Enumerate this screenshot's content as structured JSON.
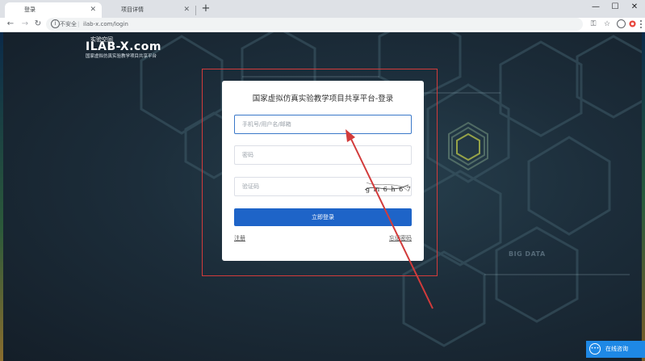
{
  "browser": {
    "tabs": [
      {
        "label": "登录",
        "active": true
      },
      {
        "label": "项目详情",
        "active": false
      }
    ],
    "window_controls": {
      "minimize": "—",
      "maximize": "☐",
      "close": "✕"
    },
    "address_bar": {
      "security_label": "不安全",
      "separator": "|",
      "url": "ilab-x.com/login"
    },
    "icons": [
      "back-icon",
      "forward-icon",
      "reload-icon",
      "info-icon",
      "key-icon",
      "star-icon",
      "profile-icon",
      "extension-icon",
      "menu-icon",
      "new-tab-icon",
      "tab-close-icon"
    ]
  },
  "logo": {
    "chinese": "实验空间",
    "english": "ILAB-X.com",
    "subtitle": "国家虚拟仿真实验教学项目共享平台"
  },
  "login": {
    "title": "国家虚拟仿真实验教学项目共享平台-登录",
    "username_placeholder": "手机号/用户名/邮箱",
    "password_placeholder": "密码",
    "captcha_placeholder": "验证码",
    "captcha_text": "g m 6 h 6 7",
    "submit_label": "立即登录",
    "register_link": "注册",
    "forgot_link": "忘记密码"
  },
  "background": {
    "watermark": "BIG DATA"
  },
  "consult": {
    "label": "在线咨询"
  },
  "colors": {
    "accent": "#1e64c8",
    "annotation": "#d23b3b",
    "consult": "#1e88e5",
    "page_bg": "#1c2d3a"
  }
}
